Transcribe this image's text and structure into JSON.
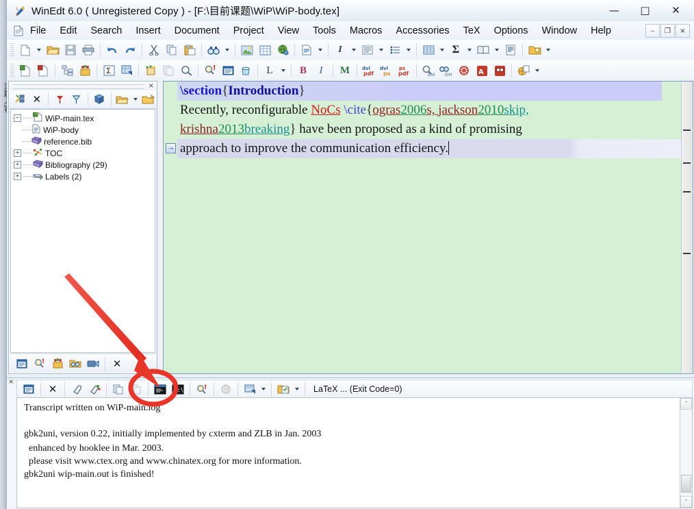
{
  "window": {
    "title": "WinEdt 6.0  ( Unregistered  Copy )  - [F:\\目前课题\\WiP\\WiP-body.tex]",
    "app_icon": "winedt-icon",
    "minimize": "—",
    "maximize": "□",
    "close": "✕",
    "mdi_minimize": "–",
    "mdi_restore": "❐",
    "mdi_close": "×"
  },
  "menubar": {
    "doc_icon": "document-icon",
    "items": [
      {
        "label": "File"
      },
      {
        "label": "Edit"
      },
      {
        "label": "Search"
      },
      {
        "label": "Insert"
      },
      {
        "label": "Document"
      },
      {
        "label": "Project"
      },
      {
        "label": "View"
      },
      {
        "label": "Tools"
      },
      {
        "label": "Macros"
      },
      {
        "label": "Accessories"
      },
      {
        "label": "TeX"
      },
      {
        "label": "Options"
      },
      {
        "label": "Window"
      },
      {
        "label": "Help"
      }
    ]
  },
  "toolbar_row1": [
    {
      "icon": "new-document-icon",
      "kind": "icon"
    },
    {
      "icon": "dropdown-arrow-icon",
      "kind": "caret"
    },
    {
      "icon": "open-folder-icon",
      "kind": "icon"
    },
    {
      "icon": "save-icon",
      "kind": "icon"
    },
    {
      "icon": "print-icon",
      "kind": "icon"
    },
    {
      "kind": "sep"
    },
    {
      "icon": "undo-icon",
      "kind": "icon"
    },
    {
      "icon": "redo-icon",
      "kind": "icon"
    },
    {
      "kind": "sep"
    },
    {
      "icon": "cut-scissors-icon",
      "kind": "icon"
    },
    {
      "icon": "copy-icon",
      "kind": "icon"
    },
    {
      "icon": "paste-icon",
      "kind": "icon"
    },
    {
      "kind": "sep"
    },
    {
      "icon": "find-binoculars-icon",
      "kind": "icon"
    },
    {
      "icon": "dropdown-arrow-icon",
      "kind": "caret"
    },
    {
      "kind": "sep"
    },
    {
      "icon": "insert-image-icon",
      "kind": "icon"
    },
    {
      "icon": "insert-table-icon",
      "kind": "icon"
    },
    {
      "icon": "web-globe-icon",
      "kind": "icon"
    },
    {
      "kind": "sep"
    },
    {
      "icon": "document-text-icon",
      "kind": "icon"
    },
    {
      "icon": "dropdown-arrow-icon",
      "kind": "caret"
    },
    {
      "kind": "sep"
    },
    {
      "icon": "italic-icon",
      "kind": "label",
      "text": "I"
    },
    {
      "icon": "dropdown-arrow-icon",
      "kind": "caret"
    },
    {
      "icon": "paragraph-align-icon",
      "kind": "icon"
    },
    {
      "icon": "dropdown-arrow-icon",
      "kind": "caret"
    },
    {
      "icon": "bullet-list-icon",
      "kind": "icon"
    },
    {
      "icon": "dropdown-arrow-icon",
      "kind": "caret"
    },
    {
      "kind": "sep"
    },
    {
      "icon": "table-grid-icon",
      "kind": "icon"
    },
    {
      "icon": "dropdown-arrow-icon",
      "kind": "caret"
    },
    {
      "icon": "sigma-math-icon",
      "kind": "label",
      "text": "Σ"
    },
    {
      "icon": "dropdown-arrow-icon",
      "kind": "caret"
    },
    {
      "icon": "book-icon",
      "kind": "icon"
    },
    {
      "icon": "dropdown-arrow-icon",
      "kind": "caret"
    },
    {
      "icon": "page-layout-icon",
      "kind": "icon"
    },
    {
      "kind": "sep"
    },
    {
      "icon": "folder-gold-icon",
      "kind": "icon"
    },
    {
      "icon": "dropdown-arrow-icon",
      "kind": "caret"
    }
  ],
  "toolbar_row2": [
    {
      "icon": "new-tex-doc-icon",
      "kind": "icon"
    },
    {
      "icon": "new-red-doc-icon",
      "kind": "icon"
    },
    {
      "kind": "sep"
    },
    {
      "icon": "tree-structure-icon",
      "kind": "icon"
    },
    {
      "icon": "package-box-icon",
      "kind": "icon"
    },
    {
      "kind": "sep"
    },
    {
      "icon": "sigma-box-icon",
      "kind": "icon"
    },
    {
      "icon": "table-insert-icon",
      "kind": "icon"
    },
    {
      "kind": "sep"
    },
    {
      "icon": "spell-check-icon",
      "kind": "icon"
    },
    {
      "icon": "document-stack-icon",
      "kind": "icon"
    },
    {
      "icon": "magnifier-icon",
      "kind": "icon"
    },
    {
      "kind": "sep"
    },
    {
      "icon": "find-error-icon",
      "kind": "icon"
    },
    {
      "icon": "log-window-icon",
      "kind": "icon"
    },
    {
      "icon": "trash-icon",
      "kind": "icon"
    },
    {
      "kind": "sep"
    },
    {
      "icon": "latex-l-icon",
      "kind": "label",
      "text": "L"
    },
    {
      "icon": "dropdown-arrow-icon",
      "kind": "caret"
    },
    {
      "kind": "sep"
    },
    {
      "icon": "bold-icon",
      "kind": "label",
      "text": "B"
    },
    {
      "icon": "italic-icon",
      "kind": "label",
      "text": "I"
    },
    {
      "kind": "sep"
    },
    {
      "icon": "metapost-m-icon",
      "kind": "label",
      "text": "M"
    },
    {
      "kind": "sep"
    },
    {
      "icon": "dvi-to-pdf-icon",
      "kind": "icon"
    },
    {
      "icon": "dvi-to-ps-icon",
      "kind": "icon"
    },
    {
      "icon": "ps-to-pdf-icon",
      "kind": "icon"
    },
    {
      "kind": "sep"
    },
    {
      "icon": "preview-dvi-icon",
      "kind": "icon"
    },
    {
      "icon": "search-dvi-icon",
      "kind": "icon"
    },
    {
      "icon": "ghostview-icon",
      "kind": "icon"
    },
    {
      "icon": "pdf-viewer-icon",
      "kind": "icon"
    },
    {
      "icon": "pdf-search-icon",
      "kind": "icon"
    },
    {
      "kind": "sep"
    },
    {
      "icon": "gold-wheel-icon",
      "kind": "icon"
    },
    {
      "icon": "dropdown-arrow-icon",
      "kind": "caret"
    }
  ],
  "tree_panel": {
    "close_glyph": "×",
    "toolbar": [
      {
        "icon": "refresh-project-icon"
      },
      {
        "icon": "close-x-icon",
        "glyph": "✕"
      },
      {
        "kind": "sep"
      },
      {
        "icon": "expand-red-marker-icon"
      },
      {
        "icon": "collapse-blue-marker-icon"
      },
      {
        "kind": "sep"
      },
      {
        "icon": "project-cube-icon"
      },
      {
        "kind": "sep"
      },
      {
        "icon": "open-folder-icon"
      },
      {
        "icon": "dropdown-arrow-icon",
        "kind": "caret"
      },
      {
        "icon": "new-folder-icon"
      }
    ],
    "items": [
      {
        "label": "WiP-main.tex",
        "icon": "tex-main-file-icon",
        "toggle": "−",
        "depth": 0
      },
      {
        "label": "WiP-body",
        "icon": "tex-file-icon",
        "toggle": "",
        "depth": 1
      },
      {
        "label": "reference.bib",
        "icon": "bib-book-icon",
        "toggle": "",
        "depth": 1
      },
      {
        "label": "TOC",
        "icon": "toc-icon",
        "toggle": "+",
        "depth": 0
      },
      {
        "label": "Bibliography  (29)",
        "icon": "bibliography-book-icon",
        "toggle": "+",
        "depth": 0
      },
      {
        "label": "Labels  (2)",
        "icon": "labels-icon",
        "toggle": "+",
        "depth": 0
      }
    ],
    "footer": [
      {
        "icon": "window-list-icon"
      },
      {
        "icon": "find-error-icon"
      },
      {
        "icon": "package-box-icon"
      },
      {
        "icon": "search-folder-icon"
      },
      {
        "icon": "camera-icon"
      },
      {
        "kind": "sep"
      },
      {
        "icon": "close-x-icon",
        "glyph": "✕"
      }
    ]
  },
  "editor": {
    "lines": [
      {
        "marker": "",
        "highlight": "section",
        "tokens": [
          {
            "text": "\\section",
            "style": "cmd"
          },
          {
            "text": "{",
            "style": "brace"
          },
          {
            "text": "Introduction",
            "style": "sectxt"
          },
          {
            "text": "}",
            "style": "brace"
          }
        ]
      },
      {
        "marker": "",
        "highlight": "none",
        "tokens": [
          {
            "text": "Recently, reconfigurable ",
            "style": "plain"
          },
          {
            "text": "NoCs",
            "style": "redu"
          },
          {
            "text": " ",
            "style": "plain"
          },
          {
            "text": "\\cite",
            "style": "cmd2"
          },
          {
            "text": "{",
            "style": "brace"
          },
          {
            "text": "ogras",
            "style": "keyr"
          },
          {
            "text": "2006",
            "style": "keyg"
          },
          {
            "text": "s, ",
            "style": "keyr"
          },
          {
            "text": "jackson",
            "style": "keyr"
          },
          {
            "text": "2010",
            "style": "keyg"
          },
          {
            "text": "skip, ",
            "style": "keyt"
          }
        ]
      },
      {
        "marker": "",
        "highlight": "none",
        "tokens": [
          {
            "text": "krishna",
            "style": "keyr"
          },
          {
            "text": "2013",
            "style": "keyg"
          },
          {
            "text": "breaking",
            "style": "keyt"
          },
          {
            "text": "}",
            "style": "brace"
          },
          {
            "text": " have been proposed as a kind of promising",
            "style": "plain"
          }
        ]
      },
      {
        "marker": "⭢",
        "highlight": "current",
        "tokens": [
          {
            "text": "approach to improve the communication efficiency.",
            "style": "plain"
          }
        ]
      }
    ]
  },
  "output_panel": {
    "close_glyph": "×",
    "toolbar": [
      {
        "icon": "output-window-icon"
      },
      {
        "kind": "sep"
      },
      {
        "icon": "close-x-icon",
        "glyph": "✕"
      },
      {
        "kind": "sep"
      },
      {
        "icon": "eraser-icon"
      },
      {
        "icon": "clear-log-icon"
      },
      {
        "kind": "sep"
      },
      {
        "icon": "copy-icon"
      },
      {
        "icon": "copy-all-icon"
      },
      {
        "kind": "sep"
      },
      {
        "icon": "console-window-icon",
        "circled": true
      },
      {
        "icon": "command-prompt-icon",
        "circled": true
      },
      {
        "kind": "sep"
      },
      {
        "icon": "find-error-icon"
      },
      {
        "kind": "sep"
      },
      {
        "icon": "stop-disabled-icon"
      },
      {
        "kind": "sep"
      },
      {
        "icon": "log-window-icon"
      },
      {
        "icon": "dropdown-arrow-icon",
        "kind": "caret"
      },
      {
        "kind": "sep"
      },
      {
        "icon": "checklist-icon"
      },
      {
        "icon": "dropdown-arrow-icon",
        "kind": "caret"
      }
    ],
    "status": "LaTeX ... (Exit Code=0)",
    "transcript": [
      "Transcript written on WiP-main.log",
      "",
      "gbk2uni, version 0.22, initially implemented by cxterm and ZLB in Jan. 2003",
      "  enhanced by hooklee in Mar. 2003.",
      "  please visit www.ctex.org and www.chinatex.org for more information.",
      "gbk2uni wip-main.out is finished!"
    ],
    "scroll_up_glyph": "˄",
    "scroll_down_glyph": "˅"
  },
  "annotations": {
    "arrow": {
      "name": "red-arrow-annotation",
      "color": "#e8372a"
    },
    "ellipse": {
      "name": "red-ellipse-annotation",
      "color": "#e8372a"
    }
  },
  "left_strip": {
    "cjk_text": "流题入客"
  },
  "colors": {
    "editor_background": "#d6f0d6",
    "section_highlight": "#ccccf8",
    "current_line_highlight": "#d8dbee",
    "annotation_red": "#e8372a",
    "title_text": "#0a0a0a"
  }
}
